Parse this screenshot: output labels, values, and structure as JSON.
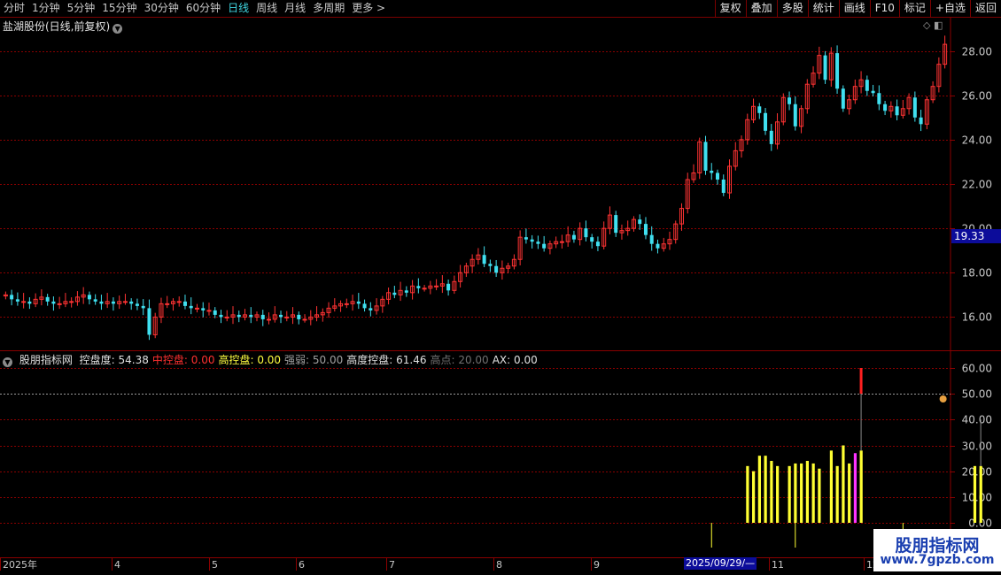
{
  "toolbar": {
    "periods": [
      "分时",
      "1分钟",
      "5分钟",
      "15分钟",
      "30分钟",
      "60分钟",
      "日线",
      "周线",
      "月线",
      "多周期",
      "更多 >"
    ],
    "active_period": "日线",
    "buttons": [
      "复权",
      "叠加",
      "多股",
      "统计",
      "画线",
      "F10",
      "标记",
      "+自选",
      "返回"
    ]
  },
  "stock": {
    "title": "盐湖股份(日线,前复权)",
    "current_price": "19.33"
  },
  "indicator": {
    "name": "股朋指标网",
    "items": [
      {
        "label": "控盘度: 54.38",
        "color": "#e0e0e0"
      },
      {
        "label": "中控盘: 0.00",
        "color": "#ff3030"
      },
      {
        "label": "高控盘: 0.00",
        "color": "#ffff40"
      },
      {
        "label": "强弱: 50.00",
        "color": "#a0a0a0"
      },
      {
        "label": "高度控盘: 61.46",
        "color": "#e0e0e0"
      },
      {
        "label": "高点: 20.00",
        "color": "#707070"
      },
      {
        "label": "AX: 0.00",
        "color": "#e0e0e0"
      }
    ]
  },
  "date_axis": {
    "labels": [
      "2025年",
      "4",
      "5",
      "6",
      "7",
      "8",
      "9",
      "11",
      "12"
    ],
    "cursor_date": "2025/09/29/—"
  },
  "watermark": {
    "line1": "股朋指标网",
    "line2": "www.7gpzb.com"
  },
  "colors": {
    "up": "#ff3333",
    "down": "#40e0f0",
    "grid": "#8a0000",
    "indicator_bar": "#ffff33",
    "magenta": "#ff33ff"
  },
  "chart_data": [
    {
      "type": "candlestick",
      "title": "盐湖股份(日线,前复权)",
      "ylim": [
        14.5,
        29.5
      ],
      "y_ticks": [
        16.0,
        18.0,
        20.0,
        22.0,
        24.0,
        26.0,
        28.0
      ],
      "close": [
        17.0,
        16.8,
        16.7,
        16.7,
        16.6,
        16.8,
        16.9,
        16.7,
        16.6,
        16.6,
        16.7,
        16.7,
        16.9,
        17.0,
        16.8,
        16.7,
        16.6,
        16.7,
        16.6,
        16.7,
        16.7,
        16.6,
        16.5,
        16.4,
        15.2,
        16.0,
        16.6,
        16.6,
        16.7,
        16.7,
        16.5,
        16.4,
        16.4,
        16.3,
        16.3,
        16.1,
        16.0,
        16.0,
        16.1,
        16.0,
        16.1,
        16.0,
        16.1,
        15.9,
        15.9,
        16.1,
        16.0,
        16.0,
        16.1,
        15.9,
        15.9,
        16.0,
        16.1,
        16.2,
        16.4,
        16.5,
        16.6,
        16.6,
        16.7,
        16.6,
        16.4,
        16.3,
        16.5,
        16.8,
        17.1,
        17.0,
        17.2,
        17.1,
        17.4,
        17.3,
        17.3,
        17.4,
        17.4,
        17.5,
        17.2,
        17.6,
        18.0,
        18.3,
        18.6,
        18.8,
        18.4,
        18.3,
        18.0,
        18.2,
        18.3,
        18.6,
        19.6,
        19.5,
        19.4,
        19.3,
        19.1,
        19.3,
        19.4,
        19.4,
        19.7,
        19.5,
        20.0,
        19.6,
        19.4,
        19.2,
        20.0,
        20.6,
        19.8,
        19.9,
        20.0,
        20.4,
        20.2,
        19.7,
        19.3,
        19.1,
        19.3,
        19.5,
        20.2,
        20.9,
        22.2,
        22.5,
        23.9,
        22.6,
        22.5,
        22.2,
        21.6,
        22.8,
        23.5,
        24.0,
        24.9,
        25.5,
        25.2,
        24.4,
        23.8,
        24.8,
        25.9,
        25.6,
        24.6,
        25.4,
        26.5,
        27.0,
        27.8,
        26.7,
        27.9,
        26.3,
        25.4,
        25.8,
        26.4,
        26.7,
        26.2,
        26.1,
        25.6,
        25.3,
        25.5,
        25.1,
        25.4,
        25.9,
        25.0,
        24.7,
        25.8,
        26.4,
        27.4,
        28.3
      ]
    },
    {
      "type": "bar",
      "title": "股朋指标网",
      "ylim": [
        0,
        65
      ],
      "y_ticks": [
        0.0,
        10.0,
        20.0,
        30.0,
        40.0,
        50.0,
        60.0
      ],
      "reference_line": 50,
      "series": [
        {
          "name": "控盘度",
          "values": [
            0,
            0,
            0,
            0,
            0,
            0,
            0,
            0,
            0,
            0,
            0,
            0,
            0,
            0,
            0,
            0,
            0,
            0,
            0,
            0,
            0,
            0,
            0,
            0,
            0,
            0,
            0,
            0,
            0,
            0,
            0,
            0,
            0,
            0,
            0,
            0,
            0,
            0,
            0,
            0,
            0,
            0,
            0,
            0,
            0,
            0,
            0,
            0,
            0,
            0,
            0,
            0,
            0,
            0,
            0,
            0,
            0,
            0,
            0,
            0,
            0,
            0,
            0,
            0,
            0,
            0,
            0,
            0,
            0,
            0,
            0,
            0,
            0,
            0,
            0,
            0,
            0,
            0,
            0,
            0,
            0,
            0,
            0,
            0,
            0,
            0,
            0,
            0,
            0,
            0,
            0,
            0,
            0,
            0,
            0,
            0,
            0,
            0,
            0,
            0,
            0,
            0,
            0,
            0,
            0,
            0,
            0,
            0,
            0,
            0,
            0,
            0,
            0,
            0,
            0,
            0,
            0,
            0,
            0,
            0,
            0,
            0,
            0,
            0,
            22,
            20,
            26,
            26,
            24,
            22,
            0,
            22,
            23,
            23,
            24,
            23,
            21,
            0,
            28,
            22,
            30,
            23,
            27,
            28,
            0,
            0,
            0,
            0,
            0,
            0,
            0,
            0,
            0,
            0,
            0,
            0,
            0,
            0,
            0,
            0,
            0,
            0,
            22,
            22
          ]
        },
        {
          "name": "高度控盘",
          "values": [
            0,
            0,
            0,
            0,
            0,
            0,
            0,
            0,
            0,
            0,
            0,
            0,
            0,
            0,
            0,
            0,
            0,
            0,
            0,
            0,
            0,
            0,
            0,
            0,
            0,
            0,
            0,
            0,
            0,
            0,
            0,
            0,
            0,
            0,
            0,
            0,
            0,
            0,
            0,
            0,
            0,
            0,
            0,
            0,
            0,
            0,
            0,
            0,
            0,
            0,
            0,
            0,
            0,
            0,
            0,
            0,
            0,
            0,
            0,
            0,
            0,
            0,
            0,
            0,
            0,
            0,
            0,
            0,
            0,
            0,
            0,
            0,
            0,
            0,
            0,
            0,
            0,
            0,
            0,
            0,
            0,
            0,
            0,
            0,
            0,
            0,
            0,
            0,
            0,
            0,
            0,
            0,
            0,
            0,
            0,
            0,
            0,
            0,
            0,
            0,
            0,
            0,
            0,
            0,
            0,
            0,
            0,
            0,
            0,
            0,
            0,
            0,
            0,
            0,
            0,
            0,
            0,
            0,
            0,
            0,
            0,
            0,
            0,
            0,
            0,
            0,
            0,
            0,
            0,
            0,
            0,
            0,
            0,
            0,
            0,
            0,
            0,
            0,
            0,
            0,
            0,
            0,
            0,
            60,
            0,
            0,
            0,
            0,
            0,
            0,
            0,
            0,
            0,
            0,
            0,
            0,
            0,
            0,
            0,
            0,
            0,
            0,
            0,
            40
          ]
        }
      ]
    }
  ]
}
